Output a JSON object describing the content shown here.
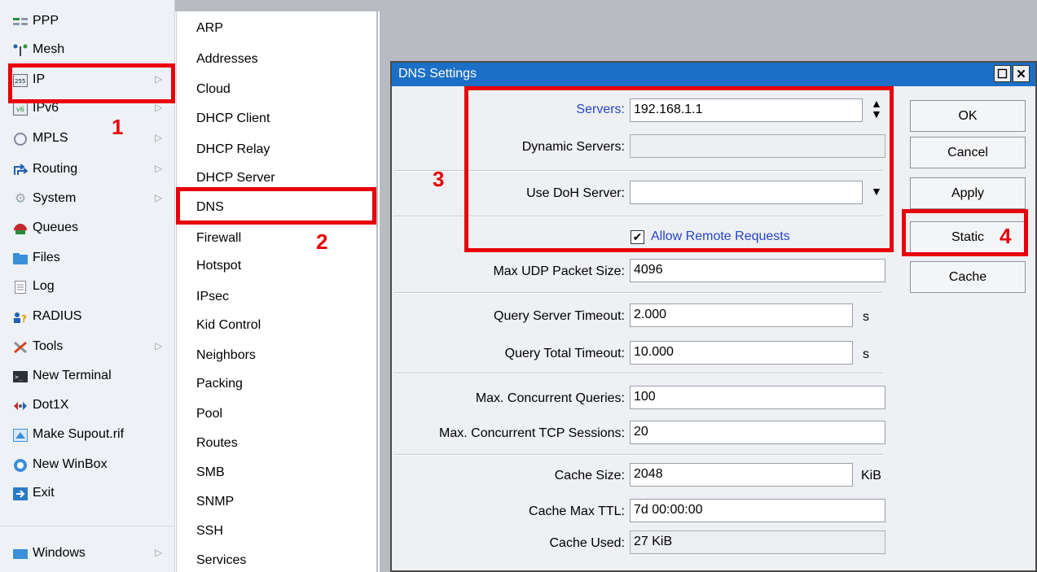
{
  "left_menu": {
    "items": [
      {
        "label": "PPP",
        "icon": "ppp-icon",
        "arrow": false
      },
      {
        "label": "Mesh",
        "icon": "mesh-icon",
        "arrow": false
      },
      {
        "label": "IP",
        "icon": "ip-icon",
        "arrow": true
      },
      {
        "label": "IPv6",
        "icon": "ipv6-icon",
        "arrow": true
      },
      {
        "label": "MPLS",
        "icon": "mpls-icon",
        "arrow": true
      },
      {
        "label": "Routing",
        "icon": "routing-icon",
        "arrow": true
      },
      {
        "label": "System",
        "icon": "gear-icon",
        "arrow": true
      },
      {
        "label": "Queues",
        "icon": "queues-icon",
        "arrow": false
      },
      {
        "label": "Files",
        "icon": "folder-icon",
        "arrow": false
      },
      {
        "label": "Log",
        "icon": "log-icon",
        "arrow": false
      },
      {
        "label": "RADIUS",
        "icon": "radius-icon",
        "arrow": false
      },
      {
        "label": "Tools",
        "icon": "tools-icon",
        "arrow": true
      },
      {
        "label": "New Terminal",
        "icon": "terminal-icon",
        "arrow": false
      },
      {
        "label": "Dot1X",
        "icon": "dot1x-icon",
        "arrow": false
      },
      {
        "label": "Make Supout.rif",
        "icon": "supout-icon",
        "arrow": false
      },
      {
        "label": "New WinBox",
        "icon": "winbox-icon",
        "arrow": false
      },
      {
        "label": "Exit",
        "icon": "exit-icon",
        "arrow": false
      },
      {
        "label": "Windows",
        "icon": "windows-icon",
        "arrow": true
      }
    ]
  },
  "sub_menu": {
    "items": [
      "ARP",
      "Addresses",
      "Cloud",
      "DHCP Client",
      "DHCP Relay",
      "DHCP Server",
      "DNS",
      "Firewall",
      "Hotspot",
      "IPsec",
      "Kid Control",
      "Neighbors",
      "Packing",
      "Pool",
      "Routes",
      "SMB",
      "SNMP",
      "SSH",
      "Services"
    ]
  },
  "dns_window": {
    "title": "DNS Settings",
    "servers_label": "Servers:",
    "servers_value": "192.168.1.1",
    "dynamic_servers_label": "Dynamic Servers:",
    "dynamic_servers_value": "",
    "doh_label": "Use DoH Server:",
    "doh_value": "",
    "allow_remote_label": "Allow Remote Requests",
    "allow_remote_checked": true,
    "max_udp_label": "Max UDP Packet Size:",
    "max_udp_value": "4096",
    "query_server_timeout_label": "Query Server Timeout:",
    "query_server_timeout_value": "2.000",
    "query_total_timeout_label": "Query Total Timeout:",
    "query_total_timeout_value": "10.000",
    "seconds_unit": "s",
    "max_concurrent_queries_label": "Max. Concurrent Queries:",
    "max_concurrent_queries_value": "100",
    "max_concurrent_tcp_label": "Max. Concurrent TCP Sessions:",
    "max_concurrent_tcp_value": "20",
    "cache_size_label": "Cache Size:",
    "cache_size_value": "2048",
    "cache_size_unit": "KiB",
    "cache_max_ttl_label": "Cache Max TTL:",
    "cache_max_ttl_value": "7d 00:00:00",
    "cache_used_label": "Cache Used:",
    "cache_used_value": "27 KiB",
    "buttons": {
      "ok": "OK",
      "cancel": "Cancel",
      "apply": "Apply",
      "static": "Static",
      "cache": "Cache"
    }
  },
  "annotations": {
    "one": "1",
    "two": "2",
    "three": "3",
    "four": "4"
  },
  "colors": {
    "title_bar": "#1b6fc6",
    "highlight": "#e8000b",
    "link": "#2244cc"
  }
}
